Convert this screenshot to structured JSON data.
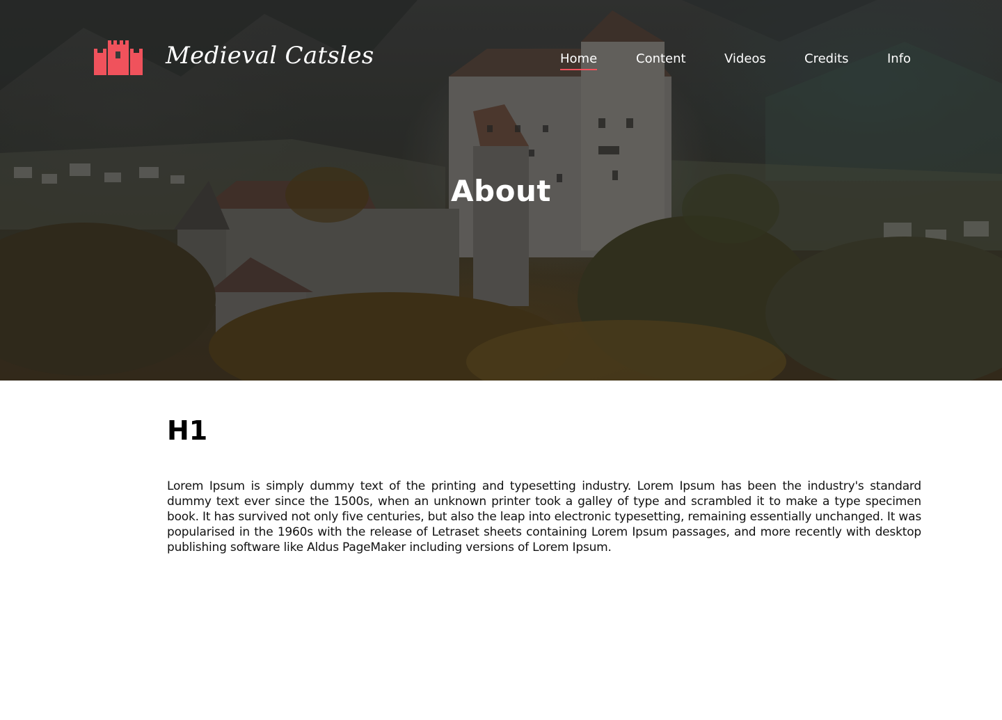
{
  "brand": {
    "name": "Medieval Catsles",
    "logo_icon": "castle-icon",
    "accent_color": "#f0525c"
  },
  "nav": {
    "items": [
      {
        "label": "Home",
        "active": true
      },
      {
        "label": "Content",
        "active": false
      },
      {
        "label": "Videos",
        "active": false
      },
      {
        "label": "Credits",
        "active": false
      },
      {
        "label": "Info",
        "active": false
      }
    ]
  },
  "hero": {
    "title": "About"
  },
  "main": {
    "heading": "H1",
    "body": "Lorem Ipsum is simply dummy text of the printing and typesetting industry. Lorem Ipsum has been the industry's standard dummy text ever since the 1500s, when an unknown printer took a galley of type and scrambled it to make a type specimen book. It has survived not only five centuries, but also the leap into electronic typesetting, remaining essentially unchanged. It was popularised in the 1960s with the release of Letraset sheets containing Lorem Ipsum passages, and more recently with desktop publishing software like Aldus PageMaker including versions of Lorem Ipsum."
  }
}
